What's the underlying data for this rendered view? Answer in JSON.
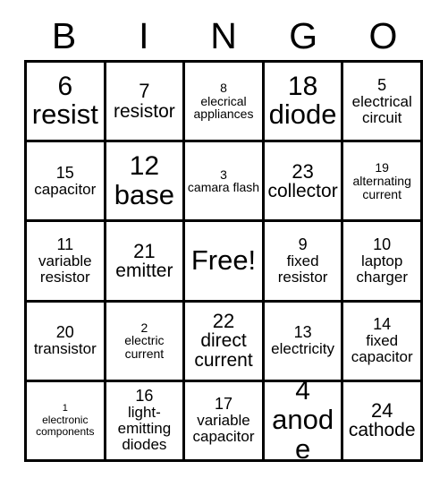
{
  "card": {
    "title_letters": [
      "B",
      "I",
      "N",
      "G",
      "O"
    ],
    "free_label": "Free!",
    "rows": [
      [
        {
          "number": "6",
          "text": "resist",
          "size": "xl"
        },
        {
          "number": "7",
          "text": "resistor",
          "size": "md"
        },
        {
          "number": "8",
          "text": "elecrical appliances",
          "size": "xs"
        },
        {
          "number": "18",
          "text": "diode",
          "size": "xl"
        },
        {
          "number": "5",
          "text": "electrical circuit",
          "size": "sm"
        }
      ],
      [
        {
          "number": "15",
          "text": "capacitor",
          "size": "sm"
        },
        {
          "number": "12",
          "text": "base",
          "size": "xl"
        },
        {
          "number": "3",
          "text": "camara flash",
          "size": "xs"
        },
        {
          "number": "23",
          "text": "collector",
          "size": "md"
        },
        {
          "number": "19",
          "text": "alternating current",
          "size": "xs"
        }
      ],
      [
        {
          "number": "11",
          "text": "variable resistor",
          "size": "sm"
        },
        {
          "number": "21",
          "text": "emitter",
          "size": "md"
        },
        {
          "number": "",
          "text": "Free!",
          "size": "free"
        },
        {
          "number": "9",
          "text": "fixed resistor",
          "size": "sm"
        },
        {
          "number": "10",
          "text": "laptop charger",
          "size": "sm"
        }
      ],
      [
        {
          "number": "20",
          "text": "transistor",
          "size": "sm"
        },
        {
          "number": "2",
          "text": "electric current",
          "size": "xs"
        },
        {
          "number": "22",
          "text": "direct current",
          "size": "md"
        },
        {
          "number": "13",
          "text": "electricity",
          "size": "sm"
        },
        {
          "number": "14",
          "text": "fixed capacitor",
          "size": "sm"
        }
      ],
      [
        {
          "number": "1",
          "text": "electronic components",
          "size": "xxs"
        },
        {
          "number": "16",
          "text": "light-emitting diodes",
          "size": "sm"
        },
        {
          "number": "17",
          "text": "variable capacitor",
          "size": "sm"
        },
        {
          "number": "4",
          "text": "anode",
          "size": "xl"
        },
        {
          "number": "24",
          "text": "cathode",
          "size": "md"
        }
      ]
    ]
  },
  "colors": {
    "background": "#ffffff",
    "border": "#000000",
    "text": "#000000"
  }
}
